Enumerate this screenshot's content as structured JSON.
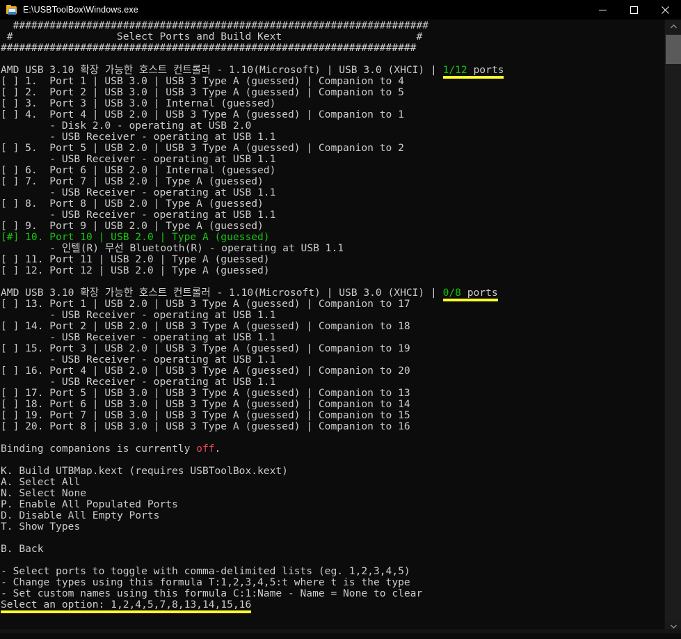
{
  "window": {
    "title": "E:\\USBToolBox\\Windows.exe",
    "icon": "folder-disk-icon",
    "buttons": {
      "minimize": "minimize-button",
      "maximize": "maximize-button",
      "close": "close-button"
    }
  },
  "colors": {
    "background": "#0c0c0c",
    "foreground": "#cccccc",
    "green": "#16c60c",
    "red": "#e74856",
    "highlight_yellow": "#ffff2e"
  },
  "console": {
    "banner": {
      "top_rule": "  ####################################################################",
      "title_line": " #                 Select Ports and Build Kext                      #",
      "bottom_rule": "####################################################################"
    },
    "controllers": [
      {
        "header_text": "AMD USB 3.10 확장 가능한 호스트 컨트롤러 - 1.10(Microsoft) | USB 3.0 (XHCI) | ",
        "ports_count": "1/12",
        "ports_suffix": " ports",
        "ports_underlined": true,
        "rows": [
          {
            "check": "[ ]",
            "text": " 1.  Port 1 | USB 3.0 | USB 3 Type A (guessed) | Companion to 4",
            "selected": false
          },
          {
            "check": "[ ]",
            "text": " 2.  Port 2 | USB 3.0 | USB 3 Type A (guessed) | Companion to 5",
            "selected": false
          },
          {
            "check": "[ ]",
            "text": " 3.  Port 3 | USB 3.0 | Internal (guessed)",
            "selected": false
          },
          {
            "check": "[ ]",
            "text": " 4.  Port 4 | USB 2.0 | USB 3 Type A (guessed) | Companion to 1",
            "selected": false
          },
          {
            "check": "",
            "text": "        - Disk 2.0 - operating at USB 2.0",
            "selected": false,
            "device": true
          },
          {
            "check": "",
            "text": "        - USB Receiver - operating at USB 1.1",
            "selected": false,
            "device": true
          },
          {
            "check": "[ ]",
            "text": " 5.  Port 5 | USB 2.0 | USB 3 Type A (guessed) | Companion to 2",
            "selected": false
          },
          {
            "check": "",
            "text": "        - USB Receiver - operating at USB 1.1",
            "selected": false,
            "device": true
          },
          {
            "check": "[ ]",
            "text": " 6.  Port 6 | USB 2.0 | Internal (guessed)",
            "selected": false
          },
          {
            "check": "[ ]",
            "text": " 7.  Port 7 | USB 2.0 | Type A (guessed)",
            "selected": false
          },
          {
            "check": "",
            "text": "        - USB Receiver - operating at USB 1.1",
            "selected": false,
            "device": true
          },
          {
            "check": "[ ]",
            "text": " 8.  Port 8 | USB 2.0 | Type A (guessed)",
            "selected": false
          },
          {
            "check": "",
            "text": "        - USB Receiver - operating at USB 1.1",
            "selected": false,
            "device": true
          },
          {
            "check": "[ ]",
            "text": " 9.  Port 9 | USB 2.0 | Type A (guessed)",
            "selected": false
          },
          {
            "check": "[#]",
            "text": " 10. Port 10 | USB 2.0 | Type A (guessed)",
            "selected": true
          },
          {
            "check": "",
            "text": "        - 인텔(R) 무선 Bluetooth(R) - operating at USB 1.1",
            "selected": false,
            "device": true
          },
          {
            "check": "[ ]",
            "text": " 11. Port 11 | USB 2.0 | Type A (guessed)",
            "selected": false
          },
          {
            "check": "[ ]",
            "text": " 12. Port 12 | USB 2.0 | Type A (guessed)",
            "selected": false
          }
        ]
      },
      {
        "header_text": "AMD USB 3.10 확장 가능한 호스트 컨트롤러 - 1.10(Microsoft) | USB 3.0 (XHCI) | ",
        "ports_count": "0/8",
        "ports_suffix": " ports",
        "ports_underlined": true,
        "rows": [
          {
            "check": "[ ]",
            "text": " 13. Port 1 | USB 2.0 | USB 3 Type A (guessed) | Companion to 17",
            "selected": false
          },
          {
            "check": "",
            "text": "        - USB Receiver - operating at USB 1.1",
            "selected": false,
            "device": true
          },
          {
            "check": "[ ]",
            "text": " 14. Port 2 | USB 2.0 | USB 3 Type A (guessed) | Companion to 18",
            "selected": false
          },
          {
            "check": "",
            "text": "        - USB Receiver - operating at USB 1.1",
            "selected": false,
            "device": true
          },
          {
            "check": "[ ]",
            "text": " 15. Port 3 | USB 2.0 | USB 3 Type A (guessed) | Companion to 19",
            "selected": false
          },
          {
            "check": "",
            "text": "        - USB Receiver - operating at USB 1.1",
            "selected": false,
            "device": true
          },
          {
            "check": "[ ]",
            "text": " 16. Port 4 | USB 2.0 | USB 3 Type A (guessed) | Companion to 20",
            "selected": false
          },
          {
            "check": "",
            "text": "        - USB Receiver - operating at USB 1.1",
            "selected": false,
            "device": true
          },
          {
            "check": "[ ]",
            "text": " 17. Port 5 | USB 3.0 | USB 3 Type A (guessed) | Companion to 13",
            "selected": false
          },
          {
            "check": "[ ]",
            "text": " 18. Port 6 | USB 3.0 | USB 3 Type A (guessed) | Companion to 14",
            "selected": false
          },
          {
            "check": "[ ]",
            "text": " 19. Port 7 | USB 3.0 | USB 3 Type A (guessed) | Companion to 15",
            "selected": false
          },
          {
            "check": "[ ]",
            "text": " 20. Port 8 | USB 3.0 | USB 3 Type A (guessed) | Companion to 16",
            "selected": false
          }
        ]
      }
    ],
    "binding_status": {
      "prefix": "Binding companions is currently ",
      "value": "off",
      "suffix": "."
    },
    "menu": [
      {
        "key": "K.",
        "label": " Build UTBMap.kext (requires USBToolBox.kext)"
      },
      {
        "key": "A.",
        "label": " Select All"
      },
      {
        "key": "N.",
        "label": " Select None"
      },
      {
        "key": "P.",
        "label": " Enable All Populated Ports"
      },
      {
        "key": "D.",
        "label": " Disable All Empty Ports"
      },
      {
        "key": "T.",
        "label": " Show Types"
      }
    ],
    "back_item": {
      "key": "B.",
      "label": " Back"
    },
    "hints": [
      "- Select ports to toggle with comma-delimited lists (eg. 1,2,3,4,5)",
      "- Change types using this formula T:1,2,3,4,5:t where t is the type",
      "- Set custom names using this formula C:1:Name - Name = None to clear"
    ],
    "prompt": {
      "label": "Select an option: ",
      "value": "1,2,4,5,7,8,13,14,15,16"
    }
  },
  "scrollbar": {
    "up_arrow": "scroll-up-arrow",
    "down_arrow": "scroll-down-arrow",
    "thumb": "scroll-thumb"
  }
}
